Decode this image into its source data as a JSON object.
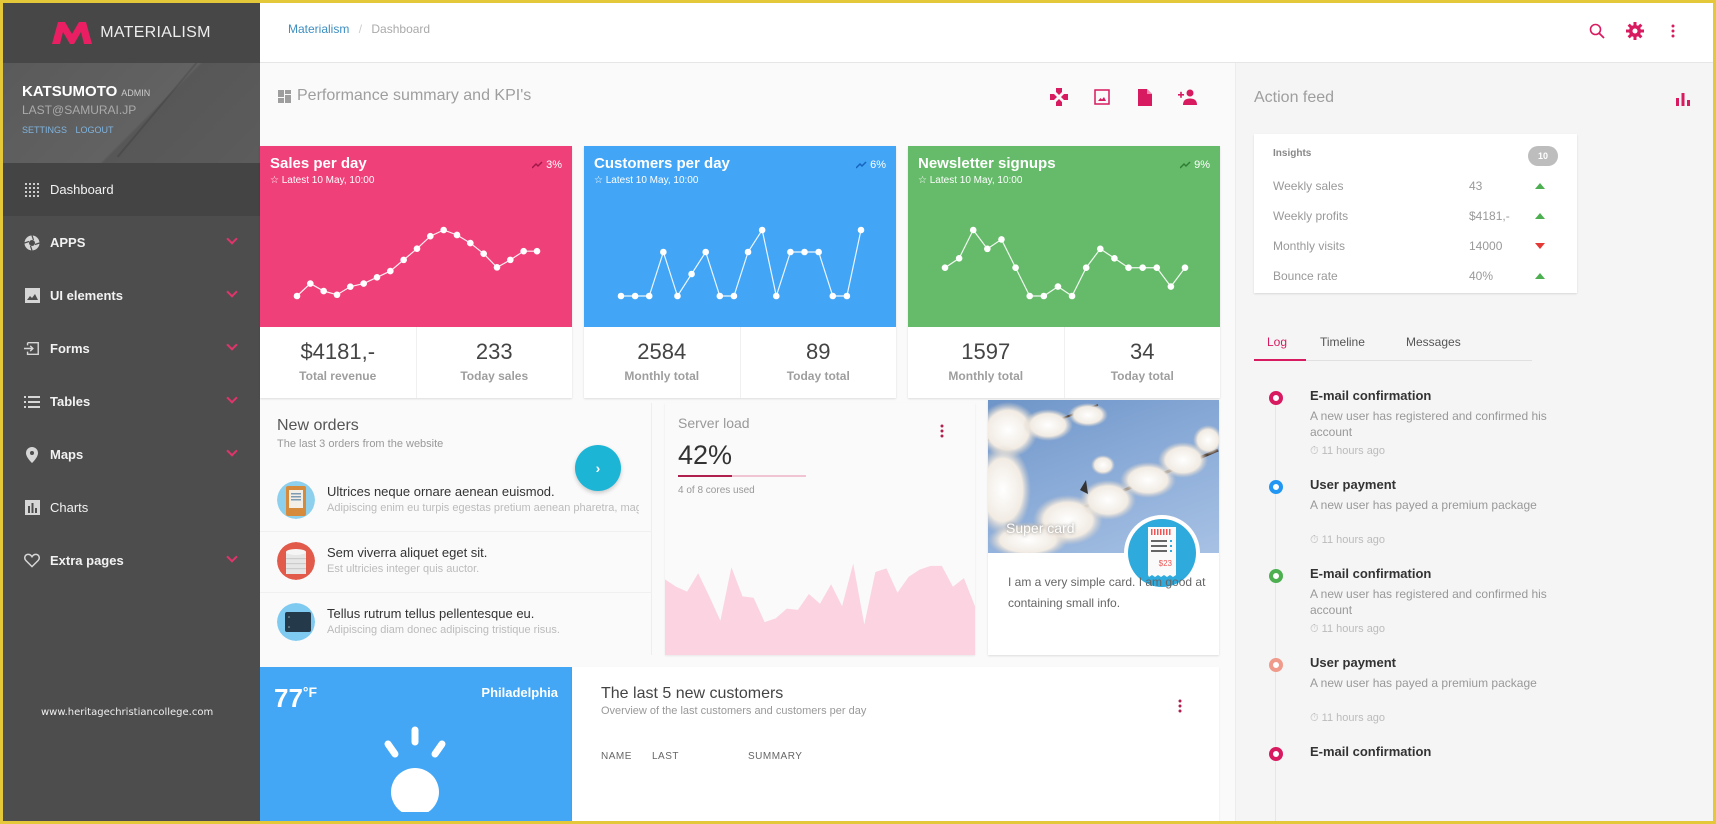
{
  "app": {
    "name": "MATERIALISM",
    "watermark": "www.heritagechristiancollege.com"
  },
  "user": {
    "name": "KATSUMOTO",
    "role": "ADMIN",
    "email": "LAST@SAMURAI.JP",
    "settings_label": "SETTINGS",
    "logout_label": "LOGOUT"
  },
  "sidebar": {
    "items": [
      {
        "label": "Dashboard",
        "icon": "grid-dots-icon",
        "expandable": false,
        "active": true
      },
      {
        "label": "APPS",
        "icon": "aperture-icon",
        "expandable": true
      },
      {
        "label": "UI elements",
        "icon": "image-icon",
        "expandable": true
      },
      {
        "label": "Forms",
        "icon": "input-icon",
        "expandable": true
      },
      {
        "label": "Tables",
        "icon": "list-icon",
        "expandable": true
      },
      {
        "label": "Maps",
        "icon": "map-pin-icon",
        "expandable": true
      },
      {
        "label": "Charts",
        "icon": "bar-chart-icon",
        "expandable": false
      },
      {
        "label": "Extra pages",
        "icon": "heart-icon",
        "expandable": true
      }
    ]
  },
  "topbar": {
    "breadcrumb": [
      "Materialism",
      "Dashboard"
    ],
    "breadcrumb_separator": "/",
    "icons": [
      "search-icon",
      "gear-icon",
      "more-vertical-icon"
    ]
  },
  "section": {
    "title": "Performance summary and KPI's",
    "actions": [
      "gamepad-icon",
      "image-icon",
      "document-icon",
      "add-user-icon"
    ]
  },
  "kpis": [
    {
      "title": "Sales per day",
      "subtitle": "Latest 10 May, 10:00",
      "trend": "3%",
      "color": "#f0407a",
      "trend_color": "#a0184a",
      "sparkline": [
        2,
        4,
        2.8,
        2.2,
        3.5,
        4,
        5,
        6,
        7.8,
        9.6,
        11.6,
        12.6,
        11.8,
        10.5,
        8.8,
        6.6,
        7.8,
        9.2,
        9.2
      ],
      "stats": [
        {
          "value": "$4181,-",
          "label": "Total revenue"
        },
        {
          "value": "233",
          "label": "Today sales"
        }
      ]
    },
    {
      "title": "Customers per day",
      "subtitle": "Latest 10 May, 10:00",
      "trend": "6%",
      "color": "#42a5f5",
      "trend_color": "#1565c0",
      "sparkline": [
        1,
        1,
        1,
        5,
        1,
        3,
        5,
        1,
        1,
        5,
        7,
        1,
        5,
        5,
        5,
        1,
        1,
        7
      ],
      "stats": [
        {
          "value": "2584",
          "label": "Monthly total"
        },
        {
          "value": "89",
          "label": "Today total"
        }
      ]
    },
    {
      "title": "Newsletter signups",
      "subtitle": "Latest 10 May, 10:00",
      "trend": "9%",
      "color": "#66bb6a",
      "trend_color": "#2e7d32",
      "sparkline": [
        4,
        5,
        8,
        6,
        7,
        4,
        1,
        1,
        2,
        1,
        4,
        6,
        5,
        4,
        4,
        4,
        2,
        4
      ],
      "stats": [
        {
          "value": "1597",
          "label": "Monthly total"
        },
        {
          "value": "34",
          "label": "Today total"
        }
      ]
    }
  ],
  "orders": {
    "title": "New orders",
    "subtitle": "The last 3 orders from the website",
    "items": [
      {
        "title": "Ultrices neque ornare aenean euismod.",
        "desc": "Adipiscing enim eu turpis egestas pretium aenean pharetra, magna",
        "avatar": "clipboard-icon"
      },
      {
        "title": "Sem viverra aliquet eget sit.",
        "desc": "Est ultricies integer quis auctor.",
        "avatar": "paper-roll-icon"
      },
      {
        "title": "Tellus rutrum tellus pellentesque eu.",
        "desc": "Adipiscing diam donec adipiscing tristique risus.",
        "avatar": "wallet-icon"
      }
    ]
  },
  "server": {
    "title": "Server load",
    "value": "42%",
    "bar_fraction": 0.42,
    "note": "4 of 8 cores used",
    "load_series": [
      0.62,
      0.56,
      0.52,
      0.67,
      0.48,
      0.28,
      0.72,
      0.48,
      0.47,
      0.27,
      0.3,
      0.38,
      0.37,
      0.5,
      0.42,
      0.58,
      0.4,
      0.75,
      0.25,
      0.68,
      0.71,
      0.51,
      0.64,
      0.7,
      0.73,
      0.73,
      0.56,
      0.63,
      0.4
    ]
  },
  "supercard": {
    "title": "Super card",
    "price": "$23",
    "text": "I am a very simple card. I am good at containing small info."
  },
  "weather": {
    "temp": "77",
    "unit": "°F",
    "city": "Philadelphia"
  },
  "customers": {
    "title": "The last 5 new customers",
    "subtitle": "Overview of the last customers and customers per day",
    "columns": [
      "NAME",
      "LAST",
      "SUMMARY"
    ]
  },
  "feed": {
    "title": "Action feed",
    "insights": {
      "title": "Insights",
      "badge": "10",
      "rows": [
        {
          "label": "Weekly sales",
          "value": "43",
          "trend": "up"
        },
        {
          "label": "Weekly profits",
          "value": "$4181,-",
          "trend": "up"
        },
        {
          "label": "Monthly visits",
          "value": "14000",
          "trend": "down"
        },
        {
          "label": "Bounce rate",
          "value": "40%",
          "trend": "up"
        }
      ]
    },
    "tabs": [
      {
        "label": "Log",
        "active": true
      },
      {
        "label": "Timeline",
        "active": false
      },
      {
        "label": "Messages",
        "active": false
      }
    ],
    "log": [
      {
        "title": "E-mail confirmation",
        "desc": "A new user has registered and confirmed his account",
        "time": "11 hours ago",
        "color": "#d81b60"
      },
      {
        "title": "User payment",
        "desc": "A new user has payed a premium package",
        "time": "11 hours ago",
        "color": "#2196f3"
      },
      {
        "title": "E-mail confirmation",
        "desc": "A new user has registered and confirmed his account",
        "time": "11 hours ago",
        "color": "#4caf50"
      },
      {
        "title": "User payment",
        "desc": "A new user has payed a premium package",
        "time": "11 hours ago",
        "color": "#ef9a8a"
      },
      {
        "title": "E-mail confirmation",
        "desc": "",
        "time": "",
        "color": "#d81b60"
      }
    ]
  },
  "colors": {
    "accent": "#d81b60",
    "sidebar_bg": "#4d4d4d",
    "link": "#3d8fc2"
  }
}
